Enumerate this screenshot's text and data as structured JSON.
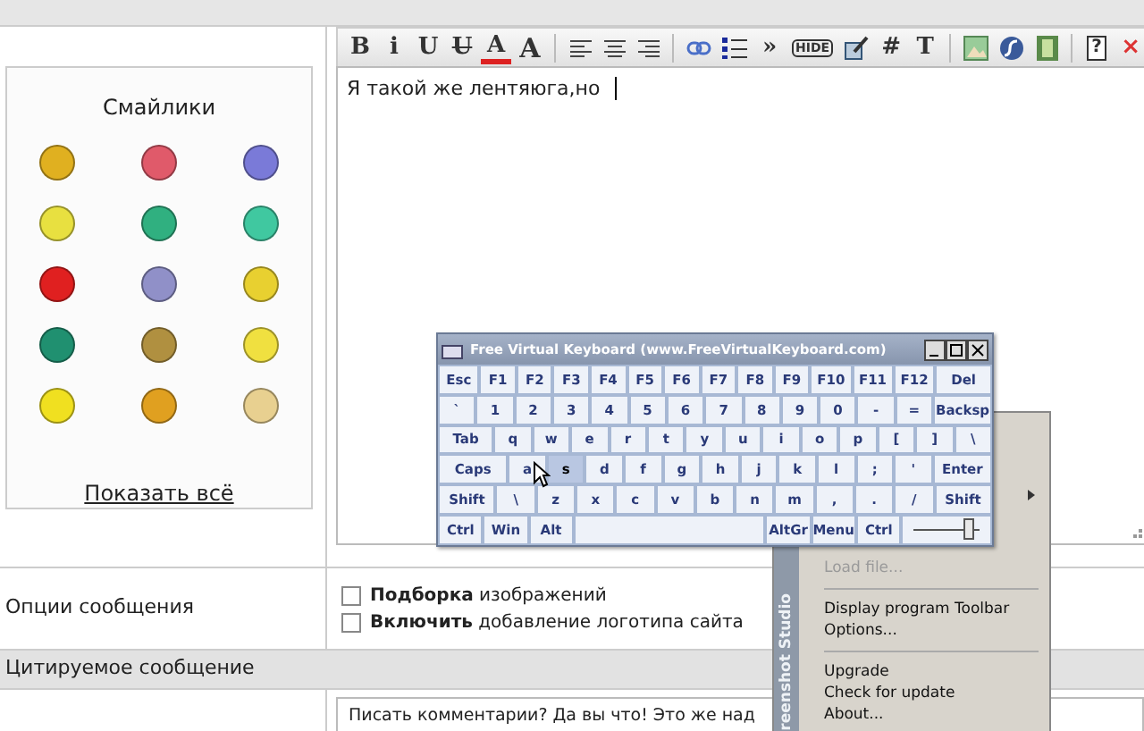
{
  "smileys_panel": {
    "title": "Смайлики",
    "smileys": [
      {
        "color": "#e0b020"
      },
      {
        "color": "#e05a6a"
      },
      {
        "color": "#7a7ad8"
      },
      {
        "color": "#e8e040"
      },
      {
        "color": "#30b080"
      },
      {
        "color": "#40c8a0"
      },
      {
        "color": "#e02020"
      },
      {
        "color": "#9090c8"
      },
      {
        "color": "#e8d030"
      },
      {
        "color": "#209070"
      },
      {
        "color": "#b09040"
      },
      {
        "color": "#f0e040"
      },
      {
        "color": "#f0e020"
      },
      {
        "color": "#e0a020"
      },
      {
        "color": "#e8d090"
      }
    ],
    "show_all_link": "Показать всё"
  },
  "editor": {
    "toolbar": [
      {
        "kind": "text",
        "label": "B"
      },
      {
        "kind": "text",
        "label": "i"
      },
      {
        "kind": "text",
        "label": "U"
      },
      {
        "kind": "strike",
        "label": "U"
      },
      {
        "kind": "fontcolor",
        "label": "A"
      },
      {
        "kind": "fontsize",
        "label": "A"
      },
      {
        "kind": "separator"
      },
      {
        "kind": "alignleft"
      },
      {
        "kind": "aligncenter"
      },
      {
        "kind": "alignright"
      },
      {
        "kind": "separator"
      },
      {
        "kind": "link"
      },
      {
        "kind": "list"
      },
      {
        "kind": "text",
        "label": "»"
      },
      {
        "kind": "tag",
        "label": "HIDE"
      },
      {
        "kind": "editimage"
      },
      {
        "kind": "text",
        "label": "#"
      },
      {
        "kind": "text",
        "label": "T"
      },
      {
        "kind": "separator"
      },
      {
        "kind": "image"
      },
      {
        "kind": "flash"
      },
      {
        "kind": "video"
      },
      {
        "kind": "separator"
      },
      {
        "kind": "help",
        "label": "?"
      },
      {
        "kind": "text",
        "label": "×"
      }
    ],
    "text": "Я такой же лентяюга,но"
  },
  "options": {
    "label": "Опции сообщения",
    "checkboxes": [
      {
        "text": "**Подборка** изображений",
        "checked": false
      },
      {
        "text": "**Включить** добавление логотипа сайта",
        "checked": false
      }
    ]
  },
  "quoted": {
    "header": "Цитируемое сообщение",
    "text": "Писать комментарии? Да вы что! Это же над"
  },
  "keyboard_window": {
    "title": "Free Virtual Keyboard (www.FreeVirtualKeyboard.com)",
    "rows": [
      {
        "keys": [
          {
            "label": "Esc",
            "selected": false
          },
          {
            "label": "F1",
            "selected": false
          },
          {
            "label": "F2",
            "selected": false
          },
          {
            "label": "F3",
            "selected": false
          },
          {
            "label": "F4",
            "selected": false
          },
          {
            "label": "F5",
            "selected": false
          },
          {
            "label": "F6",
            "selected": false
          },
          {
            "label": "F7",
            "selected": false
          },
          {
            "label": "F8",
            "selected": false
          },
          {
            "label": "F9",
            "selected": false
          },
          {
            "label": "F10",
            "selected": false
          },
          {
            "label": "F11",
            "selected": false
          },
          {
            "label": "F12",
            "selected": false
          },
          {
            "label": "Del",
            "selected": false
          }
        ]
      },
      {
        "keys": [
          {
            "label": "`",
            "selected": false
          },
          {
            "label": "1",
            "selected": false
          },
          {
            "label": "2",
            "selected": false
          },
          {
            "label": "3",
            "selected": false
          },
          {
            "label": "4",
            "selected": false
          },
          {
            "label": "5",
            "selected": false
          },
          {
            "label": "6",
            "selected": false
          },
          {
            "label": "7",
            "selected": false
          },
          {
            "label": "8",
            "selected": false
          },
          {
            "label": "9",
            "selected": false
          },
          {
            "label": "0",
            "selected": false
          },
          {
            "label": "-",
            "selected": false
          },
          {
            "label": "=",
            "selected": false
          },
          {
            "label": "Backsp",
            "selected": false
          }
        ]
      },
      {
        "keys": [
          {
            "label": "Tab",
            "selected": false
          },
          {
            "label": "q",
            "selected": false
          },
          {
            "label": "w",
            "selected": false
          },
          {
            "label": "e",
            "selected": false
          },
          {
            "label": "r",
            "selected": false
          },
          {
            "label": "t",
            "selected": false
          },
          {
            "label": "y",
            "selected": false
          },
          {
            "label": "u",
            "selected": false
          },
          {
            "label": "i",
            "selected": false
          },
          {
            "label": "o",
            "selected": false
          },
          {
            "label": "p",
            "selected": false
          },
          {
            "label": "[",
            "selected": false
          },
          {
            "label": "]",
            "selected": false
          },
          {
            "label": "\\",
            "selected": false
          }
        ]
      },
      {
        "keys": [
          {
            "label": "Caps",
            "selected": false
          },
          {
            "label": "a",
            "selected": false
          },
          {
            "label": "s",
            "selected": true
          },
          {
            "label": "d",
            "selected": false
          },
          {
            "label": "f",
            "selected": false
          },
          {
            "label": "g",
            "selected": false
          },
          {
            "label": "h",
            "selected": false
          },
          {
            "label": "j",
            "selected": false
          },
          {
            "label": "k",
            "selected": false
          },
          {
            "label": "l",
            "selected": false
          },
          {
            "label": ";",
            "selected": false
          },
          {
            "label": "'",
            "selected": false
          },
          {
            "label": "Enter",
            "selected": false
          }
        ]
      },
      {
        "keys": [
          {
            "label": "Shift",
            "selected": false
          },
          {
            "label": "\\",
            "selected": false
          },
          {
            "label": "z",
            "selected": false
          },
          {
            "label": "x",
            "selected": false
          },
          {
            "label": "c",
            "selected": false
          },
          {
            "label": "v",
            "selected": false
          },
          {
            "label": "b",
            "selected": false
          },
          {
            "label": "n",
            "selected": false
          },
          {
            "label": "m",
            "selected": false
          },
          {
            "label": ",",
            "selected": false
          },
          {
            "label": ".",
            "selected": false
          },
          {
            "label": "/",
            "selected": false
          },
          {
            "label": "Shift",
            "selected": false
          }
        ]
      },
      {
        "keys": [
          {
            "label": "Ctrl",
            "selected": false
          },
          {
            "label": "Win",
            "selected": false
          },
          {
            "label": "Alt",
            "selected": false
          },
          {
            "kind": "space",
            "selected": false
          },
          {
            "label": "AltGr",
            "selected": false
          },
          {
            "label": "Menu",
            "selected": false
          },
          {
            "label": "Ctrl",
            "selected": false
          }
        ]
      }
    ],
    "opacity_slider": {
      "level": 0.85
    }
  },
  "context_menu": {
    "side_title": "reenshot Studio",
    "items": [
      {
        "kind": "item",
        "label": "Load file...",
        "disabled": true
      },
      {
        "kind": "separator"
      },
      {
        "kind": "item",
        "label": "Display program Toolbar",
        "disabled": false
      },
      {
        "kind": "item",
        "label": "Options...",
        "disabled": false
      },
      {
        "kind": "separator"
      },
      {
        "kind": "item",
        "label": "Upgrade",
        "disabled": false
      },
      {
        "kind": "item",
        "label": "Check for update",
        "disabled": false
      },
      {
        "kind": "item",
        "label": "About...",
        "disabled": false
      }
    ]
  }
}
